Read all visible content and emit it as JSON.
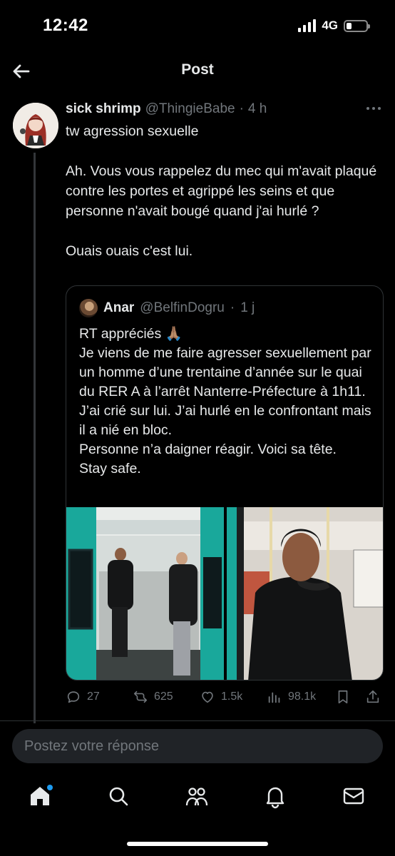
{
  "status_bar": {
    "time": "12:42",
    "network": "4G",
    "battery_level": 0.25
  },
  "header": {
    "title": "Post",
    "back_icon": "arrow-left-icon"
  },
  "post": {
    "author_name": "sick shrimp",
    "author_handle": "@ThingieBabe",
    "separator": "·",
    "time": "4 h",
    "text_lines": [
      "tw agression sexuelle",
      "",
      "Ah. Vous vous rappelez du mec qui m'avait plaqué contre les portes et agrippé les seins et que personne n'avait bougé quand j'ai hurlé ?",
      "",
      "Ouais ouais c'est lui."
    ],
    "quote": {
      "author_name": "Anar",
      "author_handle": "@BelfinDogru",
      "separator": "·",
      "time": "1 j",
      "text": "RT appréciés 🙏🏽\nJe viens de me faire agresser sexuellement par un homme d’une trentaine d’année sur le quai du RER A à l’arrêt Nanterre-Préfecture à 1h11.\nJ’ai crié sur lui. J’ai hurlé en le confrontant mais il a nié en bloc.\nPersonne n’a daigner réagir. Voici sa tête.\nStay safe."
    },
    "actions": {
      "replies": "27",
      "reposts": "625",
      "likes": "1.5k",
      "views": "98.1k"
    }
  },
  "reply_box": {
    "placeholder": "Postez votre réponse"
  },
  "bottom_nav": {
    "items": [
      "home-icon",
      "search-icon",
      "communities-icon",
      "notifications-icon",
      "messages-icon"
    ]
  },
  "colors": {
    "background": "#000000",
    "text": "#e7e9ea",
    "muted": "#71767b",
    "border": "#2f3336",
    "accent": "#1d9bf0"
  }
}
